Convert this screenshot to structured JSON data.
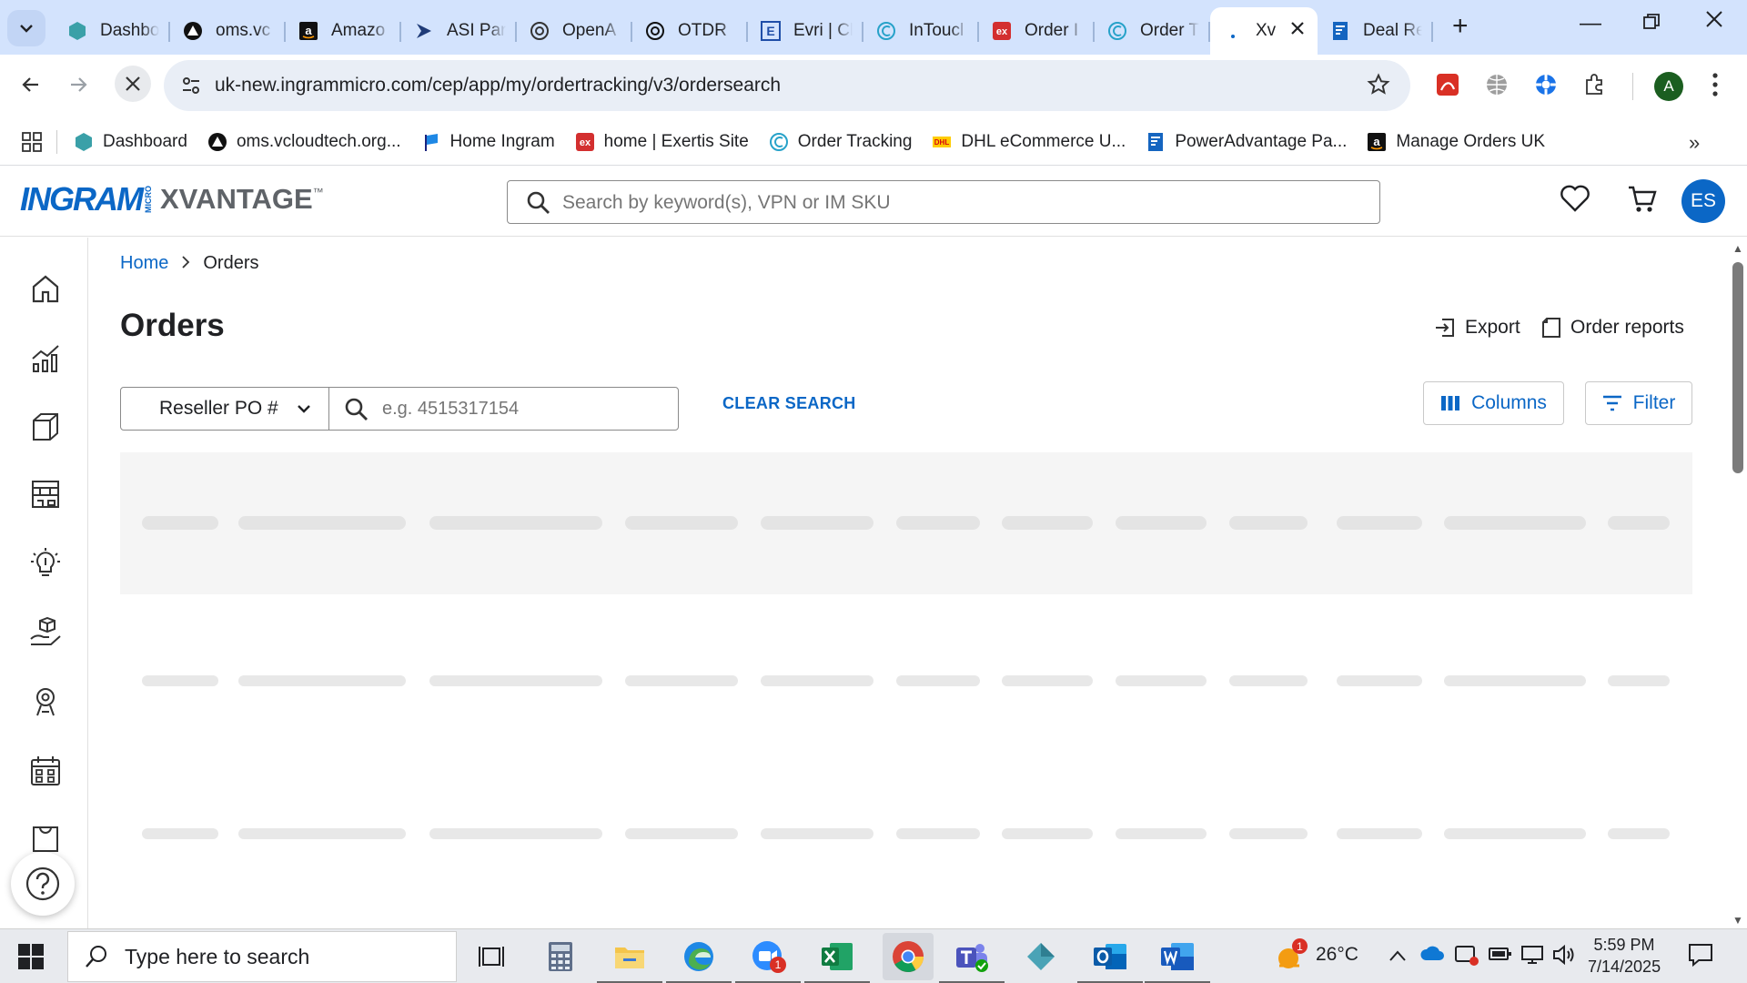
{
  "browser": {
    "tabs": [
      {
        "label": "Dashbo",
        "icon": "hexagon-icon",
        "color": "#3aa0a8"
      },
      {
        "label": "oms.vc",
        "icon": "triangle-logo-icon",
        "color": "#111111"
      },
      {
        "label": "Amazo",
        "icon": "amazon-icon",
        "color": "#111111"
      },
      {
        "label": "ASI Par",
        "icon": "arrow-logo-icon",
        "color": "#1f3b78"
      },
      {
        "label": "OpenA",
        "icon": "openai-icon",
        "color": "#333333"
      },
      {
        "label": "OTDR",
        "icon": "openai-icon",
        "color": "#111111"
      },
      {
        "label": "Evri | Cl",
        "icon": "e-logo-icon",
        "color": "#1f4ea8"
      },
      {
        "label": "InToucl",
        "icon": "c-logo-icon",
        "color": "#27a2c9"
      },
      {
        "label": "Order I",
        "icon": "exertis-icon",
        "color": "#d32f2f"
      },
      {
        "label": "Order T",
        "icon": "c-logo-icon",
        "color": "#27a2c9"
      },
      {
        "label": "Xv",
        "icon": "loading-icon",
        "color": "#0b67c6",
        "active": true
      },
      {
        "label": "Deal Re",
        "icon": "doc-logo-icon",
        "color": "#1565c0"
      }
    ],
    "url": "uk-new.ingrammicro.com/cep/app/my/ordertracking/v3/ordersearch",
    "profile_initial": "A",
    "bookmarks": [
      {
        "label": "Dashboard",
        "icon": "hexagon-icon",
        "color": "#3aa0a8"
      },
      {
        "label": "oms.vcloudtech.org...",
        "icon": "triangle-logo-icon",
        "color": "#111111"
      },
      {
        "label": "Home Ingram",
        "icon": "flag-logo-icon",
        "color": "#1e88e5"
      },
      {
        "label": "home | Exertis Site",
        "icon": "exertis-icon",
        "color": "#d32f2f"
      },
      {
        "label": "Order Tracking",
        "icon": "c-logo-icon",
        "color": "#27a2c9"
      },
      {
        "label": "DHL eCommerce U...",
        "icon": "dhl-icon",
        "color": "#ffcc00"
      },
      {
        "label": "PowerAdvantage Pa...",
        "icon": "doc-logo-icon",
        "color": "#1565c0"
      },
      {
        "label": "Manage Orders UK",
        "icon": "amazon-icon",
        "color": "#111111"
      }
    ]
  },
  "app": {
    "logo_primary": "INGRAM",
    "logo_micro": "MICRO",
    "logo_secondary": "XVANTAGE",
    "logo_tm": "™",
    "search_placeholder": "Search by keyword(s), VPN or IM SKU",
    "avatar_initials": "ES",
    "brand_color": "#0b67c6"
  },
  "page": {
    "breadcrumb": {
      "home": "Home",
      "separator": ">",
      "current": "Orders"
    },
    "title": "Orders",
    "export_label": "Export",
    "order_reports_label": "Order reports",
    "filter_select_value": "Reseller PO #",
    "filter_input_placeholder": "e.g. 4515317154",
    "clear_search_label": "CLEAR SEARCH",
    "columns_label": "Columns",
    "filter_label": "Filter"
  },
  "taskbar": {
    "search_placeholder": "Type here to search",
    "weather_badge": "1",
    "temperature": "26°C",
    "zoom_badge": "1",
    "time": "5:59 PM",
    "date": "7/14/2025"
  }
}
